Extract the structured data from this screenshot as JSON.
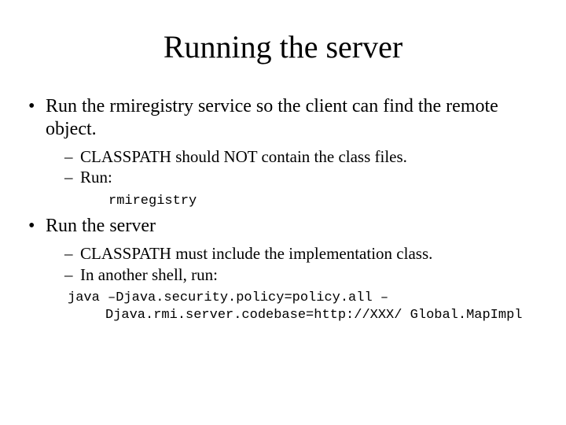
{
  "title": "Running the server",
  "bullets": [
    {
      "text": "Run the rmiregistry service so the client can find the remote object.",
      "sub": [
        {
          "text": "CLASSPATH should NOT contain the class files."
        },
        {
          "text": "Run:"
        }
      ],
      "code": "rmiregistry"
    },
    {
      "text": "Run the server",
      "sub": [
        {
          "text": "CLASSPATH must include the implementation class."
        },
        {
          "text": "In another shell, run:"
        }
      ],
      "code": "java –Djava.security.policy=policy.all –Djava.rmi.server.codebase=http://XXX/ Global.MapImpl"
    }
  ]
}
